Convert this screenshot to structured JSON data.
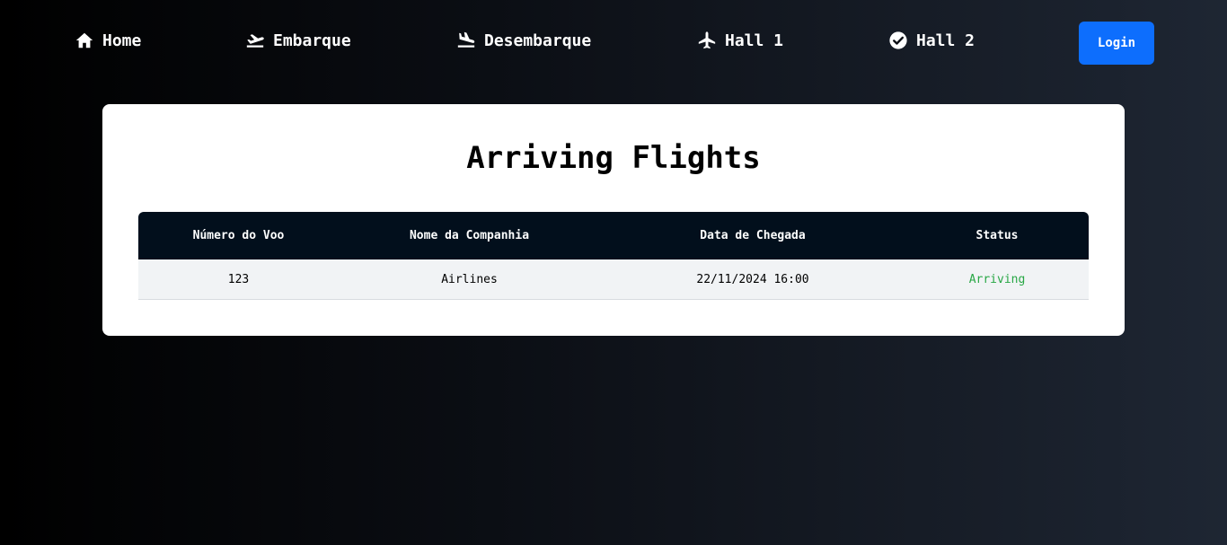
{
  "nav": {
    "items": [
      {
        "label": "Home",
        "icon": "home-icon"
      },
      {
        "label": "Embarque",
        "icon": "plane-departure-icon"
      },
      {
        "label": "Desembarque",
        "icon": "plane-arrival-icon"
      },
      {
        "label": "Hall 1",
        "icon": "plane-icon"
      },
      {
        "label": "Hall 2",
        "icon": "check-circle-icon"
      }
    ],
    "login_label": "Login"
  },
  "main": {
    "title": "Arriving Flights",
    "table": {
      "headers": [
        "Número do Voo",
        "Nome da Companhia",
        "Data de Chegada",
        "Status"
      ],
      "rows": [
        {
          "flight_number": "123",
          "company": "Airlines",
          "arrival": "22/11/2024 16:00",
          "status": "Arriving"
        }
      ]
    }
  },
  "colors": {
    "background_start": "#000000",
    "background_end": "#1e2633",
    "accent": "#0d6efd",
    "table_header": "#020f1c",
    "status_arriving": "#28a745"
  }
}
